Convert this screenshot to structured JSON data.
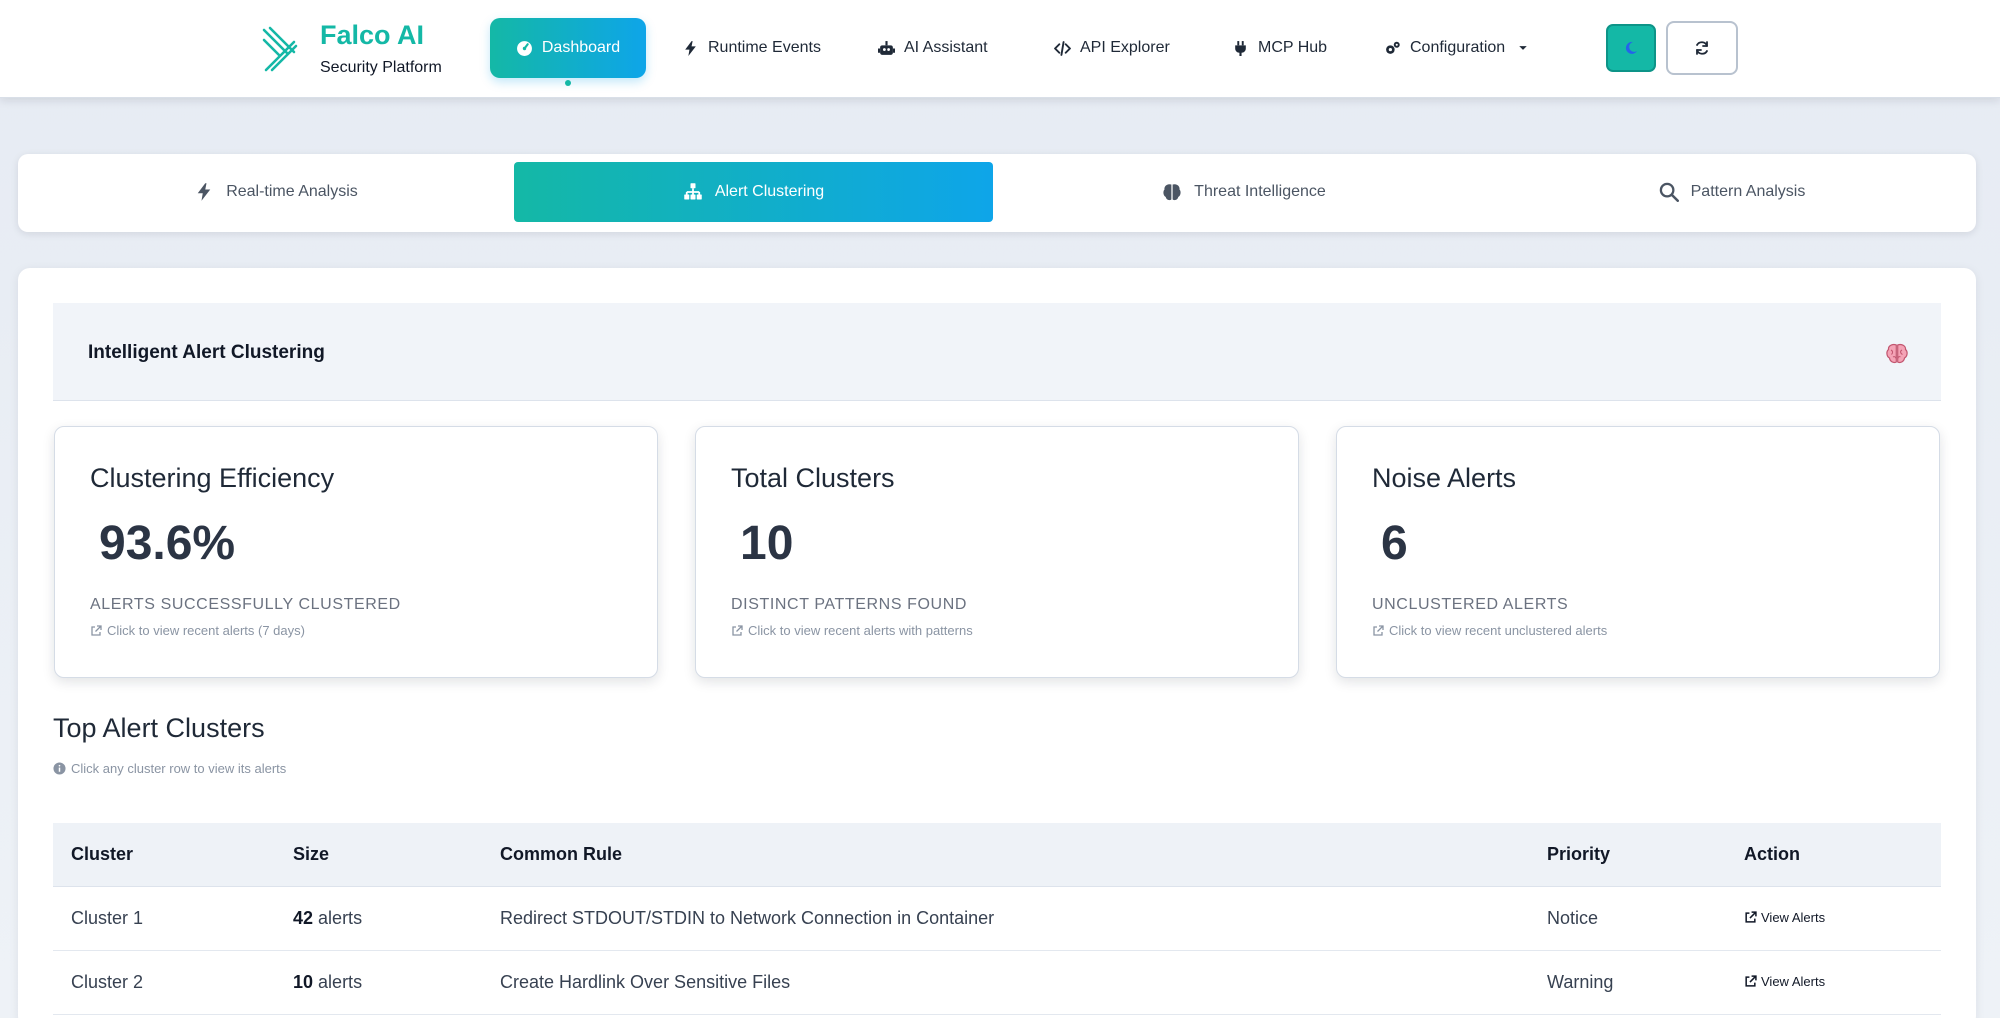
{
  "brand": {
    "name": "Falco AI",
    "subtitle": "Security Platform",
    "color": "#14b8a6"
  },
  "nav": {
    "items": [
      {
        "label": "Dashboard",
        "icon": "gauge-icon",
        "active": true
      },
      {
        "label": "Runtime Events",
        "icon": "bolt-icon"
      },
      {
        "label": "AI Assistant",
        "icon": "robot-icon"
      },
      {
        "label": "API Explorer",
        "icon": "code-icon"
      },
      {
        "label": "MCP Hub",
        "icon": "plug-icon"
      },
      {
        "label": "Configuration",
        "icon": "gears-icon",
        "dropdown": true
      }
    ],
    "theme_toggle_icon": "moon-icon",
    "refresh_icon": "refresh-icon"
  },
  "tabs": [
    {
      "label": "Real-time Analysis",
      "icon": "bolt-icon"
    },
    {
      "label": "Alert Clustering",
      "icon": "sitemap-icon",
      "active": true
    },
    {
      "label": "Threat Intelligence",
      "icon": "brain-icon"
    },
    {
      "label": "Pattern Analysis",
      "icon": "search-icon"
    }
  ],
  "section": {
    "title": "Intelligent Alert Clustering",
    "icon": "brain-icon"
  },
  "stats": [
    {
      "title": "Clustering Efficiency",
      "value": "93.6%",
      "label": "ALERTS SUCCESSFULLY CLUSTERED",
      "link": "Click to view recent alerts (7 days)"
    },
    {
      "title": "Total Clusters",
      "value": "10",
      "label": "DISTINCT PATTERNS FOUND",
      "link": "Click to view recent alerts with patterns"
    },
    {
      "title": "Noise Alerts",
      "value": "6",
      "label": "UNCLUSTERED ALERTS",
      "link": "Click to view recent unclustered alerts"
    }
  ],
  "clusters": {
    "title": "Top Alert Clusters",
    "hint": "Click any cluster row to view its alerts",
    "columns": [
      "Cluster",
      "Size",
      "Common Rule",
      "Priority",
      "Action"
    ],
    "rows": [
      {
        "cluster": "Cluster 1",
        "size": "42",
        "size_unit": "alerts",
        "rule": "Redirect STDOUT/STDIN to Network Connection in Container",
        "priority": "Notice",
        "action": "View Alerts"
      },
      {
        "cluster": "Cluster 2",
        "size": "10",
        "size_unit": "alerts",
        "rule": "Create Hardlink Over Sensitive Files",
        "priority": "Warning",
        "action": "View Alerts"
      }
    ]
  },
  "colors": {
    "accent_start": "#14b8a6",
    "accent_end": "#0ea5e9"
  }
}
